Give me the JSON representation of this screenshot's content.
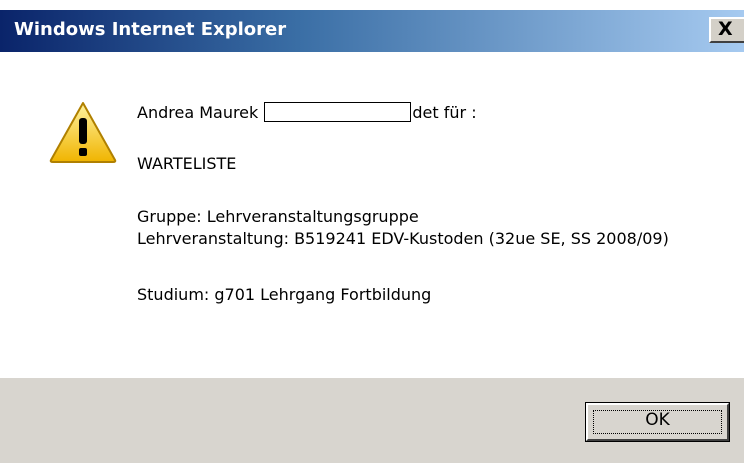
{
  "window": {
    "title": "Windows Internet Explorer",
    "close_label": "X"
  },
  "message": {
    "icon": "warning-icon",
    "name": "Andrea Maurek",
    "after_redaction": "det für :",
    "status": "WARTELISTE",
    "gruppe": "Gruppe: Lehrveranstaltungsgruppe",
    "lehrveranstaltung": "Lehrveranstaltung: B519241 EDV-Kustoden (32ue SE, SS 2008/09)",
    "studium": "Studium: g701 Lehrgang Fortbildung"
  },
  "footer": {
    "ok_label": "OK"
  },
  "colors": {
    "titlebar_start": "#0a246a",
    "titlebar_end": "#a6caf0",
    "footer_bg": "#d8d5cf",
    "warning_yellow": "#f5c400"
  }
}
